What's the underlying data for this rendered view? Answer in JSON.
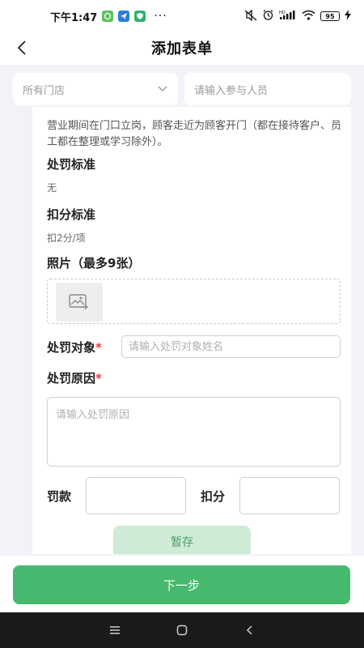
{
  "status_bar": {
    "time": "下午1:47",
    "more": "···",
    "battery": "95"
  },
  "nav": {
    "title": "添加表单"
  },
  "filters": {
    "store_select": "所有门店",
    "participant_placeholder": "请输入参与人员"
  },
  "form": {
    "description": "营业期间在门口立岗，顾客走近为顾客开门（都在接待客户、员工都在整理或学习除外）。",
    "penalty_standard_label": "处罚标准",
    "penalty_standard_value": "无",
    "deduction_standard_label": "扣分标准",
    "deduction_standard_value": "扣2分/项",
    "photo_label": "照片（最多9张）",
    "target_label": "处罚对象",
    "target_placeholder": "请输入处罚对象姓名",
    "reason_label": "处罚原因",
    "reason_placeholder": "请输入处罚原因",
    "required_mark": "*",
    "fine_label": "罚款",
    "deduct_label": "扣分",
    "draft_button": "暂存"
  },
  "footer": {
    "next_button": "下一步"
  },
  "colors": {
    "accent": "#47b96e",
    "accent_light": "#cdebd5",
    "required": "#e53935",
    "background": "#f2f3f8"
  },
  "icons": {
    "back": "chevron-left-icon",
    "dropdown": "chevron-down-icon",
    "photo_add": "image-add-icon",
    "sys_menu": "menu-icon",
    "sys_home": "home-icon",
    "sys_back": "back-icon"
  }
}
